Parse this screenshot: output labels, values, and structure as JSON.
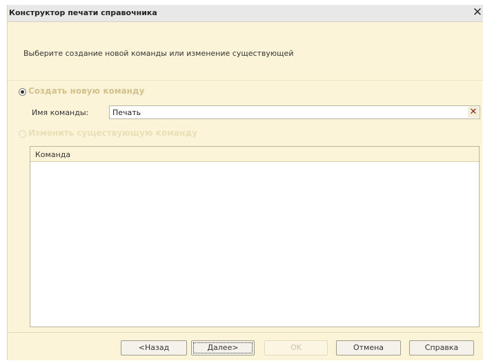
{
  "window": {
    "title": "Конструктор печати справочника"
  },
  "description": "Выберите создание новой команды или изменение существующей",
  "options": {
    "create": {
      "label": "Создать новую команду",
      "checked": true
    },
    "modify": {
      "label": "Изменить существующую команду",
      "checked": false,
      "enabled": false
    }
  },
  "command_name": {
    "label": "Имя команды:",
    "value": "Печать"
  },
  "table": {
    "columns": [
      "Команда"
    ],
    "rows": []
  },
  "buttons": {
    "back": "<Назад",
    "next": "Далее>",
    "ok": "OK",
    "cancel": "Отмена",
    "help": "Справка"
  },
  "icons": {
    "close": "close-icon",
    "clear": "clear-icon"
  }
}
